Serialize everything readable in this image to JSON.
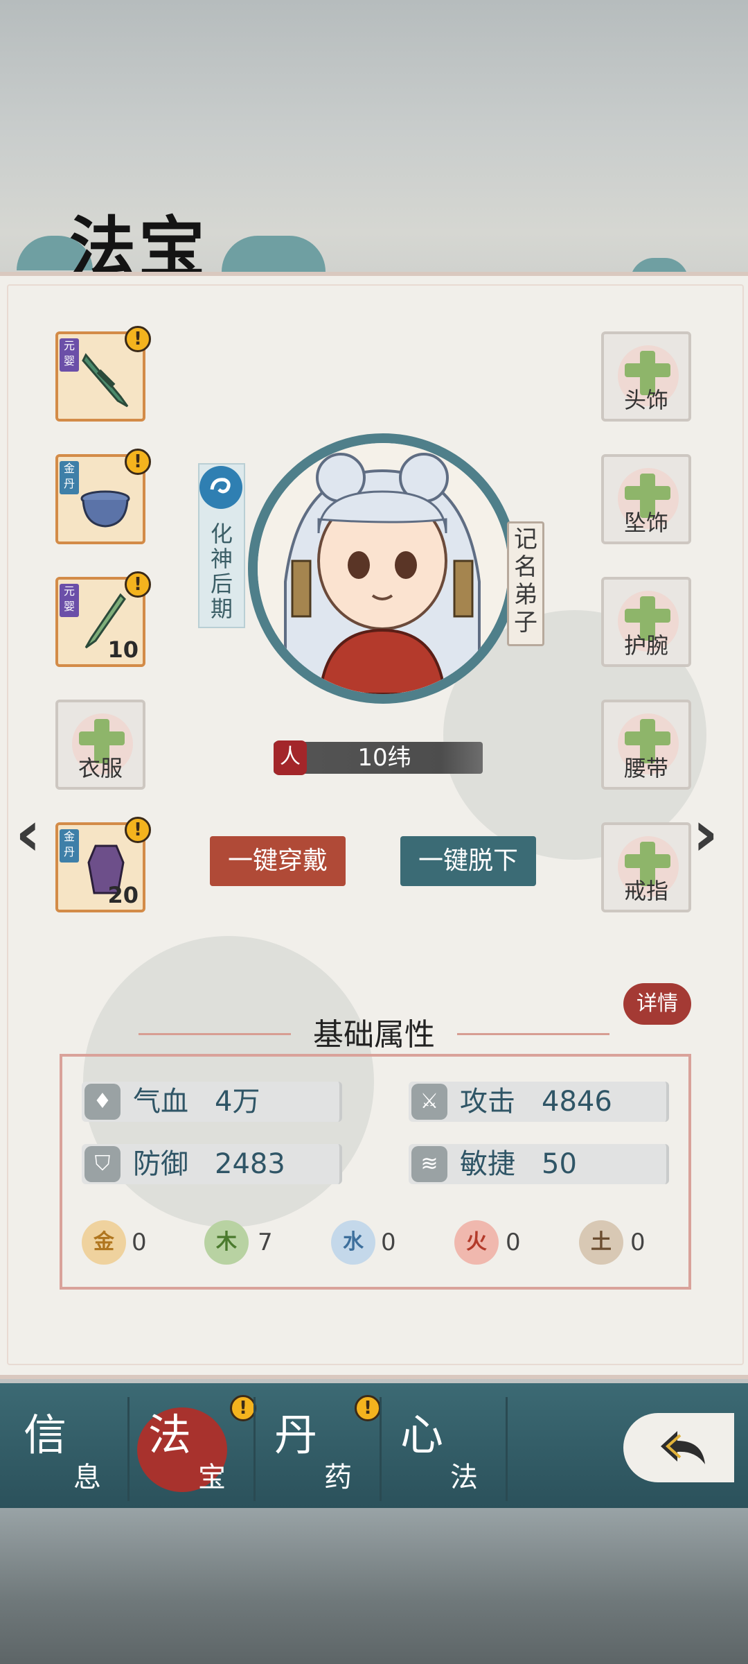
{
  "header": {
    "title": "法宝"
  },
  "left_slots": [
    {
      "grade": "元婴",
      "count": "",
      "has_alert": true,
      "alert": "!"
    },
    {
      "grade": "金丹",
      "count": "",
      "has_alert": true,
      "alert": "!"
    },
    {
      "grade": "元婴",
      "count": "10",
      "has_alert": true,
      "alert": "!"
    },
    {
      "label": "衣服",
      "empty": true
    },
    {
      "grade": "金丹",
      "count": "20",
      "has_alert": true,
      "alert": "!"
    }
  ],
  "right_slots": [
    {
      "label": "头饰"
    },
    {
      "label": "坠饰"
    },
    {
      "label": "护腕"
    },
    {
      "label": "腰带"
    },
    {
      "label": "戒指"
    }
  ],
  "character": {
    "realm": "化神后期",
    "rank": "记名弟子",
    "seal": "人",
    "value": "10纬"
  },
  "buttons": {
    "equip_all": "一键穿戴",
    "unequip_all": "一键脱下"
  },
  "attributes": {
    "section_title": "基础属性",
    "detail_label": "详情",
    "stats": [
      {
        "label": "气血",
        "value": "4万",
        "icon": "blood-drop-icon"
      },
      {
        "label": "攻击",
        "value": "4846",
        "icon": "attack-icon"
      },
      {
        "label": "防御",
        "value": "2483",
        "icon": "shield-icon"
      },
      {
        "label": "敏捷",
        "value": "50",
        "icon": "wing-icon"
      }
    ],
    "elements": [
      {
        "name": "金",
        "value": "0",
        "color": "#e6b46a"
      },
      {
        "name": "木",
        "value": "7",
        "color": "#79a25b"
      },
      {
        "name": "水",
        "value": "0",
        "color": "#7ea6c8"
      },
      {
        "name": "火",
        "value": "0",
        "color": "#d55d4c"
      },
      {
        "name": "土",
        "value": "0",
        "color": "#8a6a4c"
      }
    ]
  },
  "nav": {
    "items": [
      {
        "big": "信",
        "small": "息",
        "active": false,
        "alert": false
      },
      {
        "big": "法",
        "small": "宝",
        "active": true,
        "alert": true
      },
      {
        "big": "丹",
        "small": "药",
        "active": false,
        "alert": true
      },
      {
        "big": "心",
        "small": "法",
        "active": false,
        "alert": false
      }
    ],
    "alert_mark": "!"
  },
  "colors": {
    "accent_red": "#b04a37",
    "accent_teal": "#3b6b75",
    "badge": "#f4b31e"
  }
}
